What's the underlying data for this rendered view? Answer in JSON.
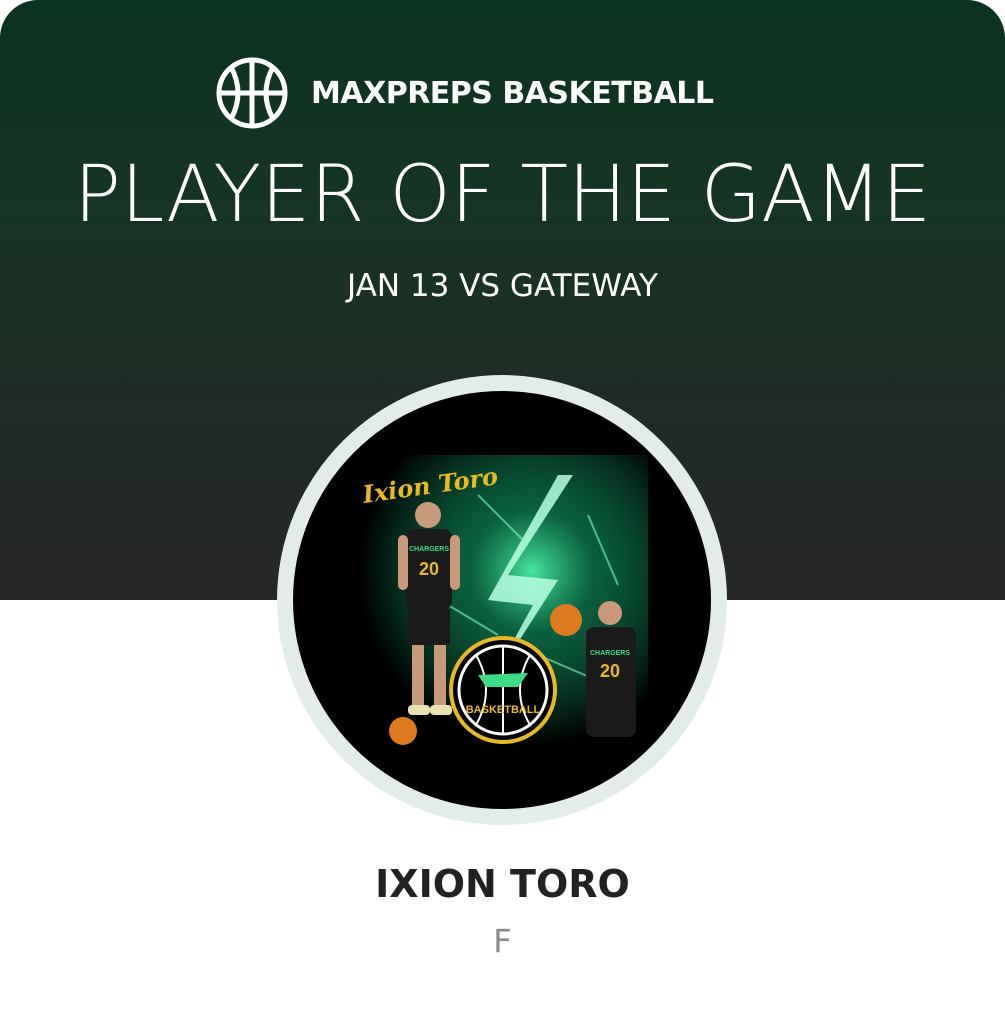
{
  "header": {
    "brand_icon": "basketball-icon",
    "brand_label": "MAXPREPS BASKETBALL",
    "title": "PLAYER OF THE GAME",
    "subtitle": "JAN 13 VS GATEWAY"
  },
  "photo": {
    "art_name": "Ixion Toro",
    "jersey_text": "CHARGERS",
    "jersey_number": "20",
    "logo_text": "BASKETBALL"
  },
  "player": {
    "name": "IXION TORO",
    "position": "F"
  },
  "colors": {
    "header_top": "#0a3320",
    "header_bottom": "#272727",
    "ring": "#e4ecea",
    "name": "#222222",
    "position": "#8a8a8a",
    "accent_gold": "#e8b923",
    "accent_green": "#3ddc84"
  }
}
